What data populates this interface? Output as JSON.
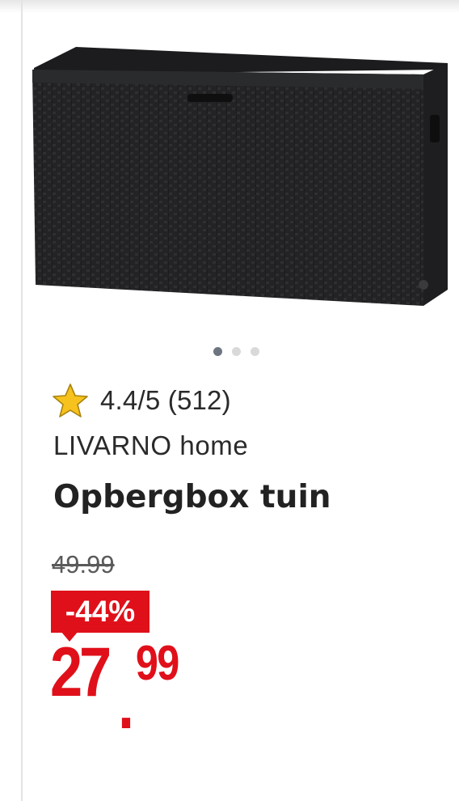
{
  "product": {
    "image_icon": "storage-box-image",
    "carousel": {
      "count": 3,
      "active": 0
    },
    "rating": {
      "icon": "star-icon",
      "text": "4.4/5 (512)"
    },
    "brand": "LIVARNO home",
    "title": "Opbergbox tuin",
    "old_price": "49.99",
    "discount": "-44%",
    "price": {
      "integer": "27",
      "separator": ".",
      "decimal": "99"
    }
  },
  "colors": {
    "accent_red": "#e0101a",
    "star_fill": "#f7c21e",
    "dot_active": "#6d7680",
    "dot_inactive": "#d9d9d9"
  }
}
